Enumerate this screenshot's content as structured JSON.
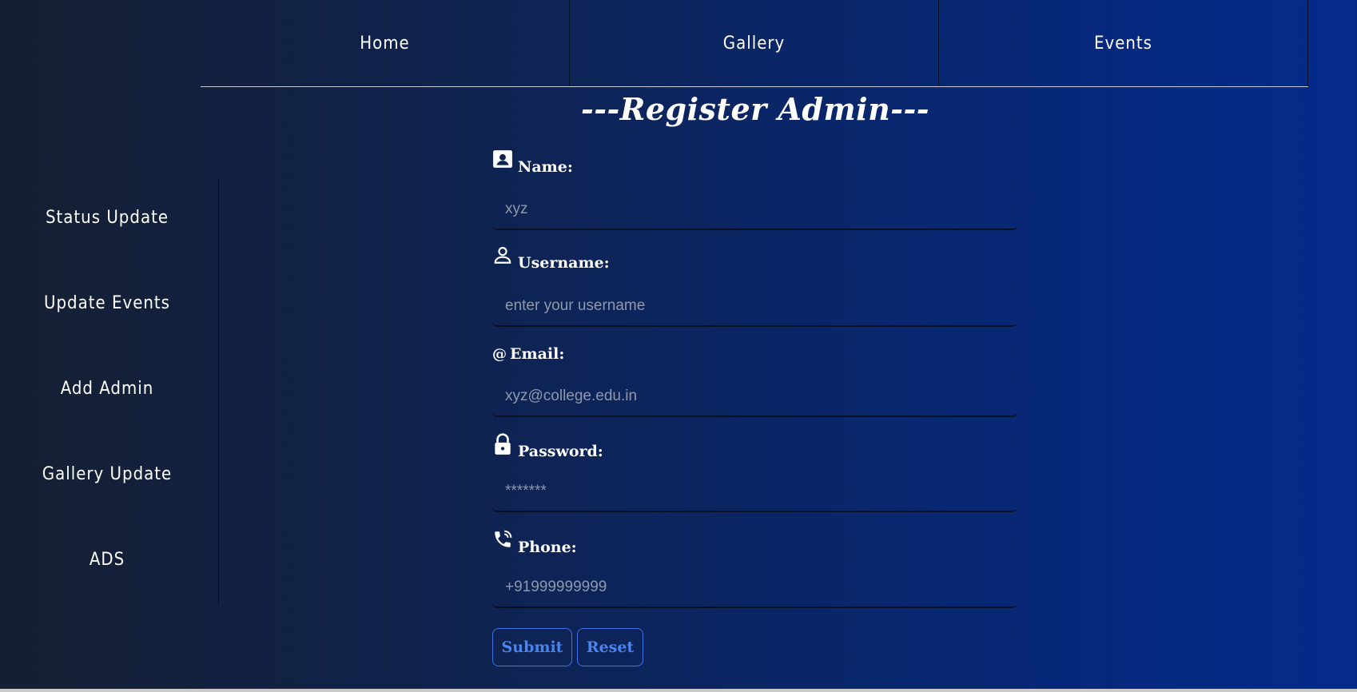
{
  "topnav": {
    "items": [
      {
        "label": "Home"
      },
      {
        "label": "Gallery"
      },
      {
        "label": "Events"
      }
    ]
  },
  "page_title": "---Register Admin---",
  "sidebar": {
    "items": [
      {
        "label": "Status Update"
      },
      {
        "label": "Update Events"
      },
      {
        "label": "Add Admin"
      },
      {
        "label": "Gallery Update"
      },
      {
        "label": "ADS"
      }
    ]
  },
  "form": {
    "name": {
      "label": "Name:",
      "icon": "contact-card-icon",
      "placeholder": "xyz",
      "value": ""
    },
    "username": {
      "label": "Username:",
      "icon": "person-icon",
      "placeholder": "enter your username",
      "value": ""
    },
    "email": {
      "label": "Email:",
      "icon_text": "@",
      "placeholder": "xyz@college.edu.in",
      "value": ""
    },
    "password": {
      "label": "Password:",
      "icon": "lock-icon",
      "placeholder": "*******",
      "value": ""
    },
    "phone": {
      "label": "Phone:",
      "icon": "phone-icon",
      "placeholder": "+91999999999",
      "value": ""
    },
    "submit_label": "Submit",
    "reset_label": "Reset"
  },
  "colors": {
    "accent": "#4a84f0",
    "text": "#ffffff",
    "placeholder": "#8f98ac"
  }
}
